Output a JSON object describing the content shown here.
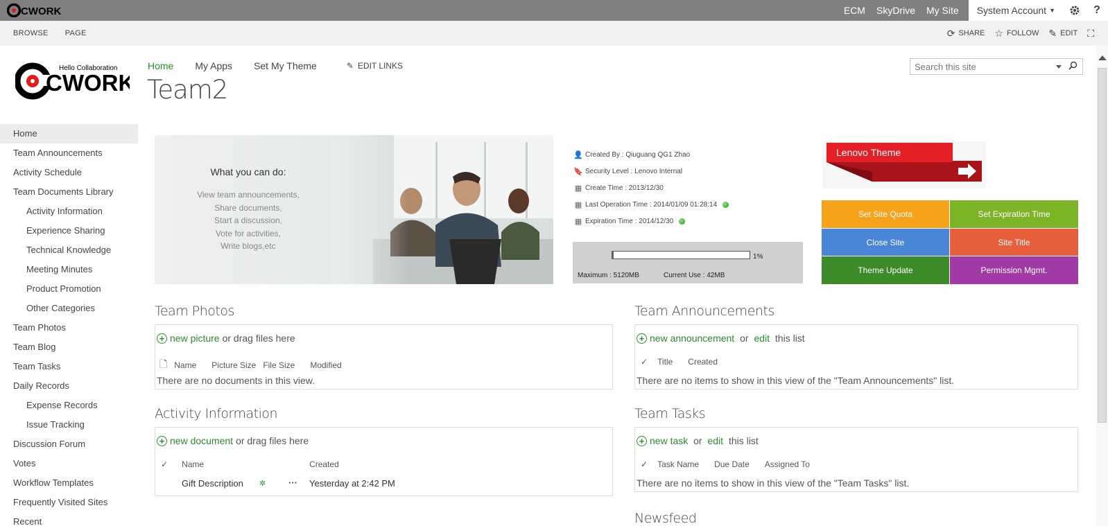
{
  "suite_bar": {
    "logo_text": "CWORK",
    "links": [
      "ECM",
      "SkyDrive",
      "My Site"
    ],
    "account": "System Account",
    "settings_icon": "gear-icon",
    "help_label": "?"
  },
  "ribbon": {
    "tabs": [
      "BROWSE",
      "PAGE"
    ],
    "share_label": "SHARE",
    "follow_label": "FOLLOW",
    "edit_label": "EDIT"
  },
  "header": {
    "logo_tagline": "Hello Collaboration",
    "logo_text": "CWORK",
    "nav": [
      "Home",
      "My Apps",
      "Set My Theme"
    ],
    "edit_links": "EDIT LINKS",
    "site_title": "Team2",
    "search_placeholder": "Search this site"
  },
  "leftnav": [
    {
      "label": "Home",
      "level": 0,
      "active": true
    },
    {
      "label": "Team Announcements",
      "level": 0
    },
    {
      "label": "Activity Schedule",
      "level": 0
    },
    {
      "label": "Team Documents Library",
      "level": 0
    },
    {
      "label": "Activity Information",
      "level": 1
    },
    {
      "label": "Experience Sharing",
      "level": 1
    },
    {
      "label": "Technical Knowledge",
      "level": 1
    },
    {
      "label": "Meeting Minutes",
      "level": 1
    },
    {
      "label": "Product Promotion",
      "level": 1
    },
    {
      "label": "Other Categories",
      "level": 1
    },
    {
      "label": "Team Photos",
      "level": 0
    },
    {
      "label": "Team Blog",
      "level": 0
    },
    {
      "label": "Team Tasks",
      "level": 0
    },
    {
      "label": "Daily Records",
      "level": 0
    },
    {
      "label": "Expense Records",
      "level": 1
    },
    {
      "label": "Issue Tracking",
      "level": 1
    },
    {
      "label": "Discussion Forum",
      "level": 0
    },
    {
      "label": "Votes",
      "level": 0
    },
    {
      "label": "Workflow Templates",
      "level": 0
    },
    {
      "label": "Frequently Visited Sites",
      "level": 0
    },
    {
      "label": "Recent",
      "level": 0
    }
  ],
  "hero": {
    "heading": "What you can do:",
    "lines": [
      "View team announcements,",
      "Share documents,",
      "Start a discussion,",
      "Vote for activities,",
      "Write blogs,etc"
    ]
  },
  "info": {
    "created_by": "Created By : Qiuguang QG1 Zhao",
    "security": "Security Level : Lenovo Internal",
    "create_time": "Create Time : 2013/12/30",
    "last_op": "Last Operation Time : 2014/01/09 01:28:14",
    "expiration": "Expiration Time : 2014/12/30"
  },
  "quota": {
    "percent_label": "1%",
    "percent_value": 1,
    "maximum": "Maximum : 5120MB",
    "current": "Current Use : 42MB"
  },
  "theme_banner": "Lenovo Theme",
  "tiles": [
    {
      "label": "Set Site Quota",
      "color": "#f7a21b"
    },
    {
      "label": "Set Expiration Time",
      "color": "#7cb327"
    },
    {
      "label": "Close Site",
      "color": "#4a86d8"
    },
    {
      "label": "Site Title",
      "color": "#e65f3a"
    },
    {
      "label": "Theme Update",
      "color": "#3c8a28"
    },
    {
      "label": "Permission Mgmt.",
      "color": "#a23aa6"
    }
  ],
  "photos": {
    "title": "Team Photos",
    "new_link": "new picture",
    "new_rest": " or drag files here",
    "cols": [
      "Name",
      "Picture Size",
      "File Size",
      "Modified"
    ],
    "empty": "There are no documents in this view."
  },
  "announcements": {
    "title": "Team Announcements",
    "new_link": "new announcement",
    "or": " or ",
    "edit_link": "edit",
    "rest": " this list",
    "cols": [
      "Title",
      "Created"
    ],
    "empty": "There are no items to show in this view of the \"Team Announcements\" list."
  },
  "activity": {
    "title": "Activity Information",
    "new_link": "new document",
    "new_rest": " or drag files here",
    "cols": [
      "Name",
      "Created"
    ],
    "row_name": "Gift Description",
    "row_more": "···",
    "row_created": "Yesterday at 2:42 PM"
  },
  "tasks": {
    "title": "Team Tasks",
    "new_link": "new task",
    "or": " or ",
    "edit_link": "edit",
    "rest": " this list",
    "cols": [
      "Task Name",
      "Due Date",
      "Assigned To"
    ],
    "empty": "There are no items to show in this view of the \"Team Tasks\" list."
  },
  "newsfeed": {
    "title": "Newsfeed"
  }
}
